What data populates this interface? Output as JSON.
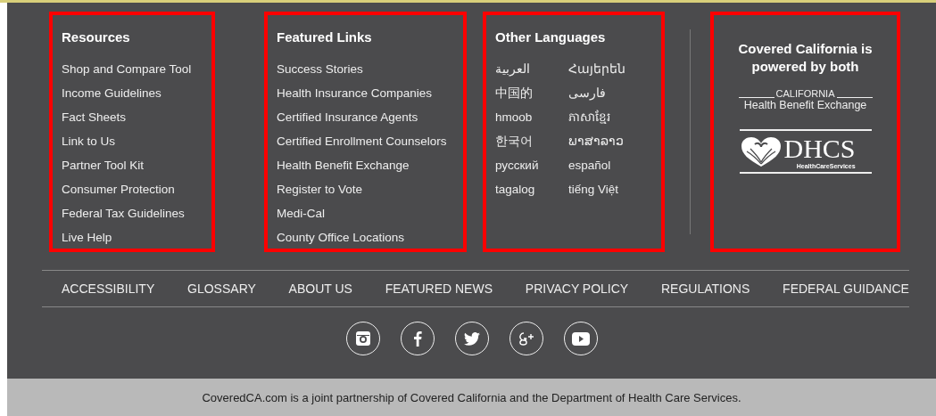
{
  "columns": [
    {
      "title": "Resources",
      "highlighted": true,
      "links": [
        "Shop and Compare Tool",
        "Income Guidelines",
        "Fact Sheets",
        "Link to Us",
        "Partner Tool Kit",
        "Consumer Protection",
        "Federal Tax Guidelines",
        "Live Help"
      ]
    },
    {
      "title": "Featured Links",
      "highlighted": true,
      "links": [
        "Success Stories",
        "Health Insurance Companies",
        "Certified Insurance Agents",
        "Certified Enrollment Counselors",
        "Health Benefit Exchange",
        "Register to Vote",
        "Medi-Cal",
        "County Office Locations"
      ]
    }
  ],
  "languages": {
    "title": "Other Languages",
    "highlighted": true,
    "items": [
      "العربية",
      "Հայերեն",
      "中国的",
      "فارسی",
      "hmoob",
      "ភាសាខ្មែរ",
      "한국어",
      "ພາສາລາວ",
      "русский",
      "español",
      "tagalog",
      "tiếng Việt"
    ]
  },
  "partners": {
    "title": "Covered California is powered by both",
    "highlighted": true,
    "exchange_logo": {
      "top": "CALIFORNIA",
      "bottom": "Health Benefit Exchange"
    },
    "dhcs_logo": {
      "name": "DHCS",
      "tagline": "HealthCareServices"
    }
  },
  "nav": [
    "ACCESSIBILITY",
    "GLOSSARY",
    "ABOUT US",
    "FEATURED NEWS",
    "PRIVACY POLICY",
    "REGULATIONS",
    "FEDERAL GUIDANCE"
  ],
  "social": [
    {
      "kind": "instagram"
    },
    {
      "kind": "facebook"
    },
    {
      "kind": "twitter"
    },
    {
      "kind": "googleplus"
    },
    {
      "kind": "youtube"
    }
  ],
  "footer_note": "CoveredCA.com is a joint partnership of Covered California and the Department of Health Care Services."
}
